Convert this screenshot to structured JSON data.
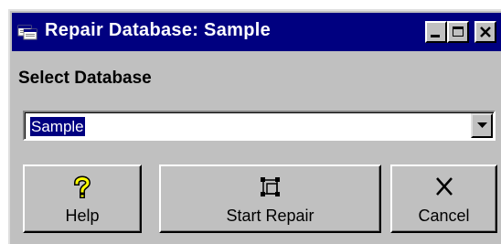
{
  "window": {
    "title": "Repair Database: Sample",
    "app_icon": "database-window-icon",
    "controls": {
      "minimize_icon": "minimize-icon",
      "maximize_icon": "maximize-icon",
      "close_icon": "close-icon"
    }
  },
  "form": {
    "section_label": "Select Database",
    "database_select": {
      "value": "Sample",
      "arrow_icon": "chevron-down-icon"
    }
  },
  "buttons": {
    "help": {
      "label": "Help",
      "icon": "question-mark-icon"
    },
    "start_repair": {
      "label": "Start Repair",
      "icon": "repair-icon"
    },
    "cancel": {
      "label": "Cancel",
      "icon": "x-icon"
    }
  },
  "colors": {
    "title_bar": "#000080",
    "face": "#c0c0c0",
    "selection": "#000080",
    "help_icon": "#ffff00"
  }
}
